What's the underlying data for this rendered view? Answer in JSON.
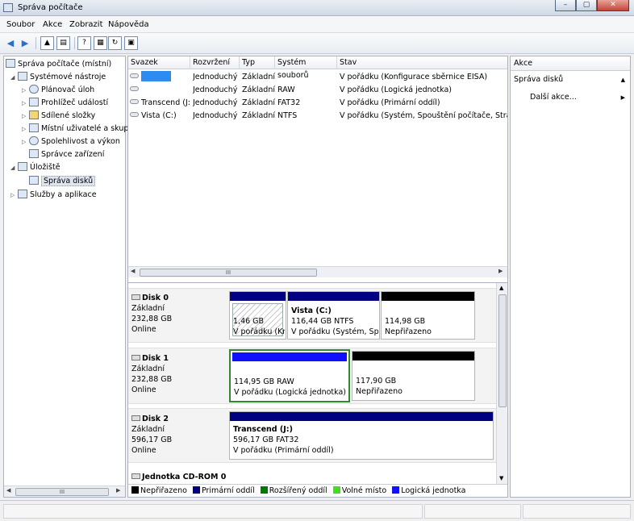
{
  "window": {
    "title": "Správa počítače",
    "buttons": {
      "minimize": "–",
      "maximize": "▢",
      "close": "✕"
    }
  },
  "menu": [
    "Soubor",
    "Akce",
    "Zobrazit",
    "Nápověda"
  ],
  "tree": {
    "root": "Správa počítače (místní)",
    "system_tools": "Systémové nástroje",
    "task_scheduler": "Plánovač úloh",
    "event_viewer": "Prohlížeč událostí",
    "shared_folders": "Sdílené složky",
    "local_users": "Místní uživatelé a skupin",
    "reliability": "Spolehlivost a výkon",
    "device_manager": "Správce zařízení",
    "storage": "Úložiště",
    "disk_management": "Správa disků",
    "services": "Služby a aplikace"
  },
  "volume_list": {
    "columns": [
      "Svazek",
      "Rozvržení",
      "Typ",
      "Systém souborů",
      "Stav"
    ],
    "rows": [
      {
        "name": "",
        "layout": "Jednoduchý",
        "type": "Základní",
        "fs": "",
        "status": "V pořádku (Konfigurace sběrnice EISA)"
      },
      {
        "name": "",
        "layout": "Jednoduchý",
        "type": "Základní",
        "fs": "RAW",
        "status": "V pořádku (Logická jednotka)"
      },
      {
        "name": "Transcend (J:)",
        "layout": "Jednoduchý",
        "type": "Základní",
        "fs": "FAT32",
        "status": "V pořádku (Primární oddíl)"
      },
      {
        "name": "Vista (C:)",
        "layout": "Jednoduchý",
        "type": "Základní",
        "fs": "NTFS",
        "status": "V pořádku (Systém, Spouštění počítače, Stránkovac"
      }
    ]
  },
  "disks": [
    {
      "name": "Disk 0",
      "type": "Základní",
      "size": "232,88 GB",
      "state": "Online",
      "partitions": [
        {
          "label": "",
          "size": "1,46 GB",
          "status": "V pořádku (Kn"
        },
        {
          "label": "Vista (C:)",
          "size": "116,44 GB NTFS",
          "status": "V pořádku (Systém, Spuš"
        },
        {
          "label": "",
          "size": "114,98 GB",
          "status": "Nepřiřazeno"
        }
      ]
    },
    {
      "name": "Disk 1",
      "type": "Základní",
      "size": "232,88 GB",
      "state": "Online",
      "partitions": [
        {
          "label": "",
          "size": "114,95 GB RAW",
          "status": "V pořádku (Logická jednotka)"
        },
        {
          "label": "",
          "size": "117,90 GB",
          "status": "Nepřiřazeno"
        }
      ]
    },
    {
      "name": "Disk 2",
      "type": "Základní",
      "size": "596,17 GB",
      "state": "Online",
      "partitions": [
        {
          "label": "Transcend (J:)",
          "size": "596,17 GB FAT32",
          "status": "V pořádku (Primární oddíl)"
        }
      ]
    },
    {
      "name": "Jednotka CD-ROM 0"
    }
  ],
  "legend": [
    "Nepřiřazeno",
    "Primární oddíl",
    "Rozšířený oddíl",
    "Volné místo",
    "Logická jednotka"
  ],
  "actions": {
    "header": "Akce",
    "section": "Správa disků",
    "more": "Další akce..."
  },
  "scroll_glyph": "III",
  "colors": {
    "unallocated": "#000000",
    "primary": "#000080",
    "extended": "#007a00",
    "free": "#44dd22",
    "logical": "#1010ff",
    "selected_border": "#2f8a2f"
  }
}
